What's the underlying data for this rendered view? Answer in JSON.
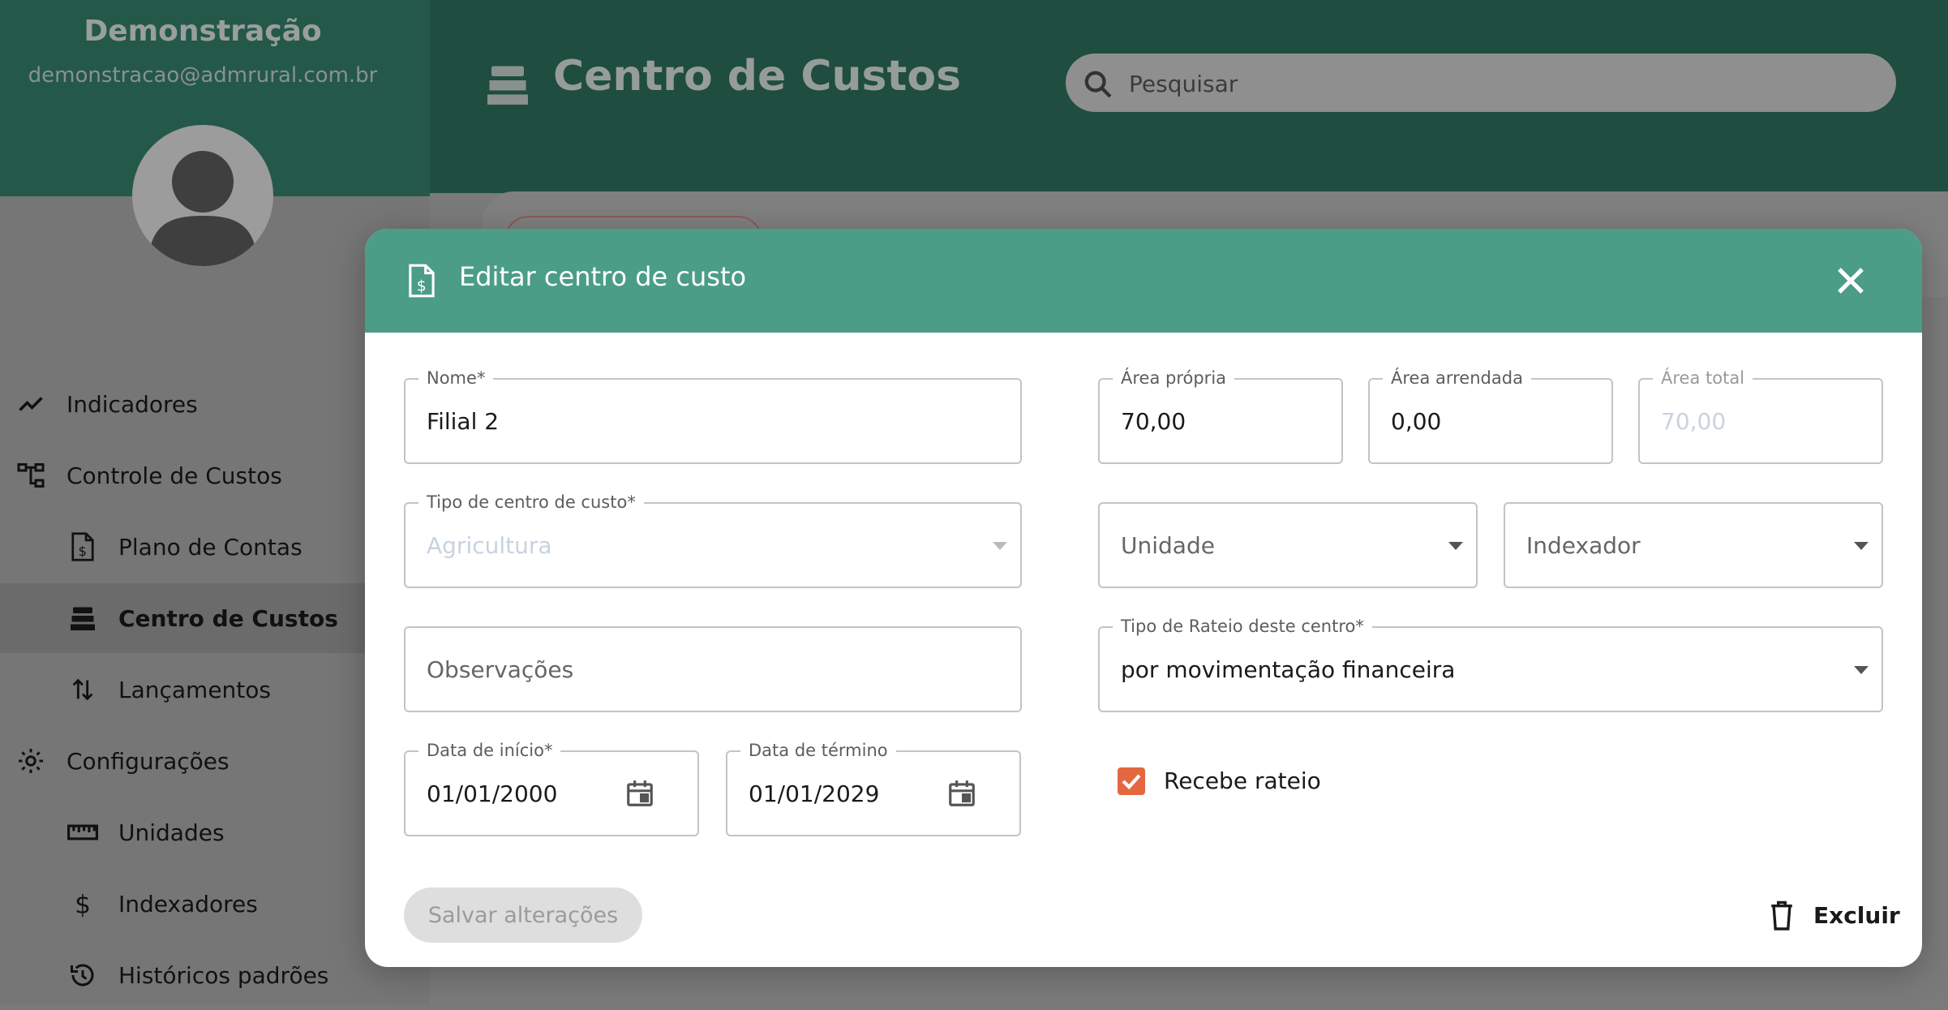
{
  "sidebar": {
    "user_name": "Demonstração",
    "user_email": "demonstracao@admrural.com.br",
    "items": [
      {
        "label": "Indicadores"
      },
      {
        "label": "Controle de Custos"
      },
      {
        "label": "Plano de Contas"
      },
      {
        "label": "Centro de Custos"
      },
      {
        "label": "Lançamentos"
      },
      {
        "label": "Configurações"
      },
      {
        "label": "Unidades"
      },
      {
        "label": "Indexadores"
      },
      {
        "label": "Históricos padrões"
      }
    ]
  },
  "header": {
    "title": "Centro de Custos",
    "search_placeholder": "Pesquisar"
  },
  "modal": {
    "title": "Editar centro de custo",
    "nome": {
      "label": "Nome",
      "required": "*",
      "value": "Filial 2"
    },
    "area_propria": {
      "label": "Área própria",
      "value": "70,00"
    },
    "area_arrendada": {
      "label": "Área arrendada",
      "value": "0,00"
    },
    "area_total": {
      "label": "Área total",
      "value": "70,00"
    },
    "tipo_centro": {
      "label": "Tipo de centro de custo",
      "required": "*",
      "value": "Agricultura"
    },
    "unidade": {
      "placeholder": "Unidade"
    },
    "indexador": {
      "placeholder": "Indexador"
    },
    "observacoes": {
      "placeholder": "Observações"
    },
    "tipo_rateio": {
      "label": "Tipo de Rateio deste centro",
      "required": "*",
      "value": "por movimentação financeira"
    },
    "data_inicio": {
      "label": "Data de início",
      "required": "*",
      "value": "01/01/2000"
    },
    "data_termino": {
      "label": "Data de término",
      "value": "01/01/2029"
    },
    "recebe_rateio": {
      "label": "Recebe rateio",
      "checked": true
    },
    "save_label": "Salvar alterações",
    "delete_label": "Excluir"
  },
  "colors": {
    "header_green": "#1f4d3f",
    "modal_header": "#4b9d87",
    "checkbox_orange": "#e4683f"
  }
}
